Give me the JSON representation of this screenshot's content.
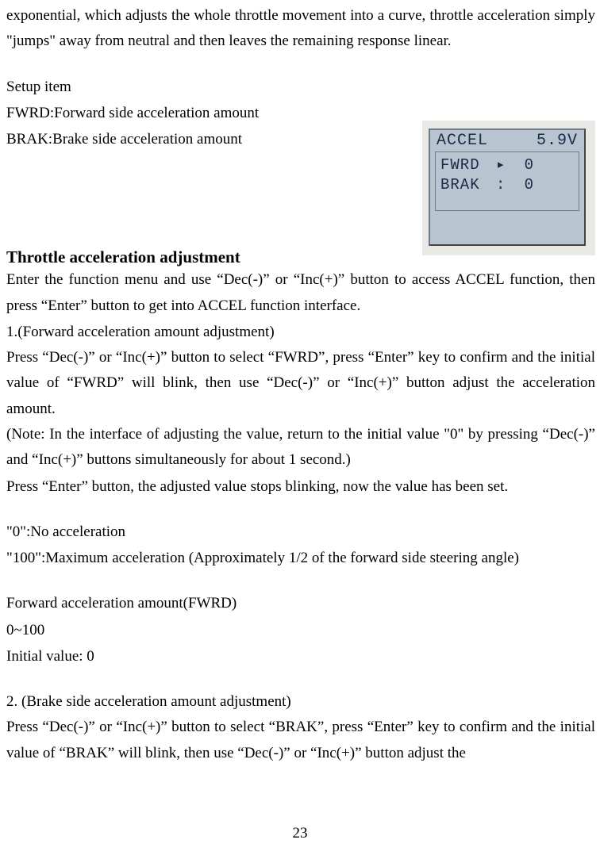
{
  "intro": "exponential, which adjusts the whole throttle movement into a curve, throttle acceleration simply \"jumps\" away from neutral and then leaves the remaining response linear.",
  "setup": {
    "header": "Setup item",
    "fwrd": "FWRD:Forward side acceleration amount",
    "brak": "BRAK:Brake side acceleration amount"
  },
  "lcd": {
    "title": "ACCEL",
    "voltage": "5.9V",
    "rows": [
      {
        "label": "FWRD",
        "mark": "▸",
        "value": "0"
      },
      {
        "label": "BRAK",
        "mark": ":",
        "value": "0"
      }
    ]
  },
  "heading": "Throttle acceleration adjustment",
  "body": {
    "p1": "Enter the function menu and use  “Dec(-)” or “Inc(+)” button to access ACCEL function, then press “Enter” button to get into ACCEL function interface.",
    "p2": "1.(Forward acceleration amount adjustment)",
    "p3": "Press “Dec(-)” or “Inc(+)” button to select “FWRD”, press “Enter” key to confirm and the initial value of “FWRD” will blink, then use “Dec(-)” or “Inc(+)” button adjust the acceleration amount.",
    "p4": "(Note: In the interface of adjusting the value, return to the initial value \"0\" by pressing “Dec(-)” and “Inc(+)” buttons simultaneously for about 1 second.)",
    "p5": "Press  “Enter” button, the adjusted value stops blinking, now the value has been set.",
    "p6": "\"0\":No acceleration",
    "p7": "\"100\":Maximum acceleration (Approximately 1/2 of the forward side steering angle)",
    "p8": "Forward acceleration amount(FWRD)",
    "p9": "0~100",
    "p10": "Initial value: 0",
    "p11": "2. (Brake side acceleration amount adjustment)",
    "p12": "Press “Dec(-)” or “Inc(+)” button to select “BRAK”, press “Enter” key to confirm and the initial value of “BRAK” will blink, then use “Dec(-)” or “Inc(+)” button adjust the"
  },
  "page_number": "23"
}
